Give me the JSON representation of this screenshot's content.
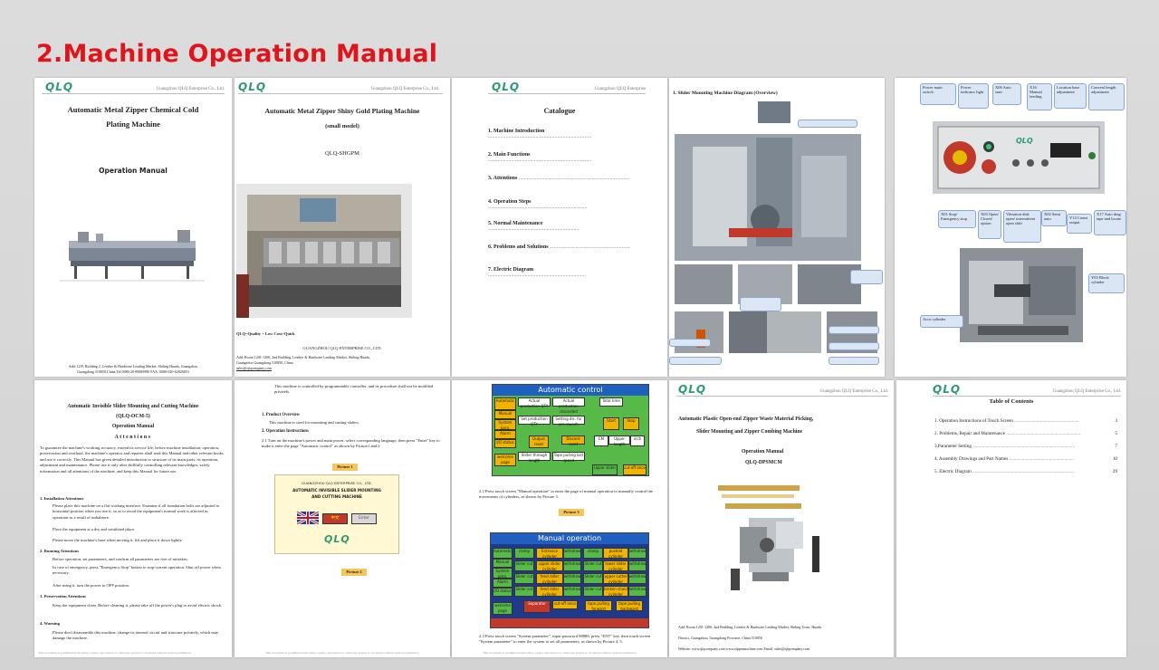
{
  "slide_title": "2.Machine Operation Manual",
  "brand_logo": "QLQ",
  "p1": {
    "header": "Guangzhou QLQ Enterprise Co., Ltd.",
    "title_line1": "Automatic Metal Zipper Chemical Cold",
    "title_line2": "Plating Machine",
    "subtitle": "Operation Manual",
    "address1": "Add: 12/F, Building 2, Leather & Hardware Leading Market, Shiling Huadu, Guangzhou",
    "address2": "Guangdong 510850,China,Tel:0086-20-89689980    FAX: 0086-020-62826853"
  },
  "p2": {
    "header": "Guangzhou QLQ Enterprise Co., Ltd.",
    "title": "Automatic Metal Zipper Shiny Gold Plating Machine",
    "model_note": "(small model)",
    "model": "QLQ-SHGPM",
    "slogan": "QLQ=Quality + Low Cost+Quick",
    "company": "GUANGZHOU QLQ ENTERPRISE CO., LTD.",
    "address1": "Add: Room 1201-1206, 2nd Building, Leather & Hardware Leading Market, Shiling Huadu,",
    "address2": "Guangzhou Guangdong 510850, China",
    "email": "sales@qlqcompany.com"
  },
  "p3": {
    "header": "Guangzhou QLQ Enterprise",
    "title": "Catalogue",
    "items": [
      "1. Machine Introduction",
      "2. Main Functions",
      "3. Attentions",
      "4. Operation Steps",
      "5. Normal Maintenance",
      "6. Problems and Solutions",
      "7. Electric Diagram"
    ]
  },
  "p4": {
    "title": "1.  Slider Mounting Machine Diagram (Overview)"
  },
  "p5": {
    "callouts_top": [
      "Power main switch",
      "Power indicator light",
      "X06 Auto start",
      "X16 Manual feeding",
      "Location base adjustment",
      "Conveal length adjustment"
    ],
    "callouts_bottom": [
      "X01 Stop/ Emergency stop",
      "X03 Open/ Closed option",
      "Vibration disk open/ intermittent open shift",
      "X02 Semi auto",
      "Y14 Count output",
      "X17 Auto drag tape and locate"
    ],
    "label_block": "Y03 Block cylinder",
    "label_accu": "Accu cylinder"
  },
  "p6": {
    "title": "Automatic Invisible Slider Mounting and Cutting Machine",
    "model": "(QLQ-OCM-5)",
    "subtitle": "Operation Manual",
    "attn": "Attentions",
    "intro": "To guarantee the machine's working accuracy, extend its service life, before machine installation, operation, preservation and overhaul, the machine's operator and repairer shall read this Manual and other relevant books and use it correctly. This Manual has given detailed introduction to structure of its main parts, its operation, adjustment and maintenance. Please use it only after skillfully controlling relevant knowledges, safety information and all attentions of the machine, and keep this Manual for future use.",
    "s1": "1. Installation Attentions",
    "s1_items": [
      "Please place this machine on a flat working interface. Examine if all foundation bolts are adjusted to horizontal position when you use it, so as to avoid the equipment's normal work is affected in operation as a result of imbalance.",
      "Place the equipment at a dry and ventilated place.",
      "Please move the machine's base when moving it, lift and place it down lightly."
    ],
    "s2": "2. Running Attentions",
    "s2_items": [
      "Before operation, set parameters, and confirm all parameters are free of mistakes.",
      "In case of emergency, press \"Emergency Stop\" button to stop current operation. Shut off power when necessary.",
      "After using it, turn the power to OFF position."
    ],
    "s3": "3. Preservation Attentions",
    "s3_items": [
      "Keep the equipment clean. Before cleaning it, please take off the power's plug to avoid electric shock."
    ],
    "s4": "4. Warning",
    "s4_items": [
      "Please don't disassemble this machine, change its internal circuit and structure privately, which may damage the machine."
    ],
    "footer": "This document is prohibited from being copied, reproduced or otherwise spread or circulated without written permission."
  },
  "p7": {
    "top_text": "This machine is controlled by programmable controller, and its procedure shall not be modified privately.",
    "s1": "1. Product Overview",
    "s1_text": "This machine is used for mounting and cutting sliders.",
    "s2": "2. Operation Instructions",
    "s2_text": "2.1  Turn on the machine's power and main power, select corresponding language, then press \"Enter\" key to make it enter the page \"Automatic control\" as shown by Picture1 and 2.",
    "pic1": "Picture 1",
    "pic2": "Picture 2",
    "screen_company": "GUANGZHOU QLQ ENTERPRISE CO., LTD.",
    "screen_title1": "AUTOMATIC INVISIBLE SLIDER MOUNTING",
    "screen_title2": "AND CUTTING MACHINE",
    "lang_cn": "中文",
    "lang_en": "Enter",
    "footer": "This document is prohibited from being copied, reproduced or otherwise spread or circulated without written permission."
  },
  "p8": {
    "auto_title": "Automatic control",
    "auto_buttons": [
      "Automatic",
      "Manual",
      "System para.",
      "Alarm",
      "I/O status",
      "welcome page"
    ],
    "auto_labels": [
      "Actual production QTY",
      "Actual production discarded",
      "Total time",
      "Set production QTY",
      "Setting dis. for pre-launch",
      "Start",
      "Stop",
      "Output reset",
      "Discard reset",
      "CM",
      "Upper length",
      "inch",
      "Slider through length",
      "Tape pulling last speed",
      "Upper slider",
      "cut-off once"
    ],
    "text1": "2.2 Press touch screen  \"Manual operation\"  to enter the page of manual operation to manually control the movements of cylinders, as shown by Picture 3.",
    "pic3": "Picture 3",
    "man_title": "Manual operation",
    "man_buttons": [
      "Automatic",
      "Manual",
      "System para.",
      "Alarm",
      "I/O status",
      "welcome page"
    ],
    "man_labels": [
      "clamp",
      "Entrance cylinder",
      "withdraw",
      "clamp",
      "pushed cylinder",
      "withdraw",
      "Slider cut",
      "upper slider cylinder",
      "withdraw",
      "Slider cut",
      "lower slider cylinder",
      "withdraw",
      "Slider cut",
      "feed roller cylinder",
      "withdraw",
      "Slider cut",
      "upper cutter cylinder",
      "withdraw",
      "Slider cut",
      "feed roller cylinder",
      "withdraw",
      "Slider cut",
      "broken chain cylinder",
      "withdraw",
      "Separator",
      "cut-off once",
      "tape pulling forward",
      "tape pulling backward"
    ],
    "text2": "2.3 Press touch screen  \"System parameter\", input password 88888, press \"ENT\" key, then touch screen \"System parameter\" to enter the system to set all parameters, as shown by Picture 4, 5.",
    "footer": "This document is prohibited from being copied, reproduced or otherwise spread or circulated without written permission."
  },
  "p9": {
    "header": "Guangzhou QLQ Enterprise Co., Ltd.",
    "title1": "Automatic Plastic Open-end Zipper Waste Material Picking,",
    "title2": "Slider Mounting and Zipper Combing Machine",
    "subtitle": "Operation Manual",
    "model": "QLQ-DPSMCM",
    "address1": "Add: Room 1201-1206, 2nd Building, Leather & Hardware Leading Market, Shiling Town, Huadu",
    "address2": "District, Guangzhou, Guangdong Province, China 510850",
    "web": "Website: www.qlqcompany.com   www.zippermachine.com          Email: sales@qlqcompany.com"
  },
  "p10": {
    "header": "Guangzhou QLQ Enterprise Co., Ltd.",
    "title": "Table of Contents",
    "items": [
      {
        "label": "1. Operation Instructions of Touch Screen",
        "page": "3"
      },
      {
        "label": "2. Problems, Repair and Maintenance",
        "page": "5"
      },
      {
        "label": "3.Parameter Setting",
        "page": "7"
      },
      {
        "label": "4. Assembly Drawings and Part Names",
        "page": "10"
      },
      {
        "label": "5. Electric Diagram",
        "page": "29"
      }
    ]
  }
}
